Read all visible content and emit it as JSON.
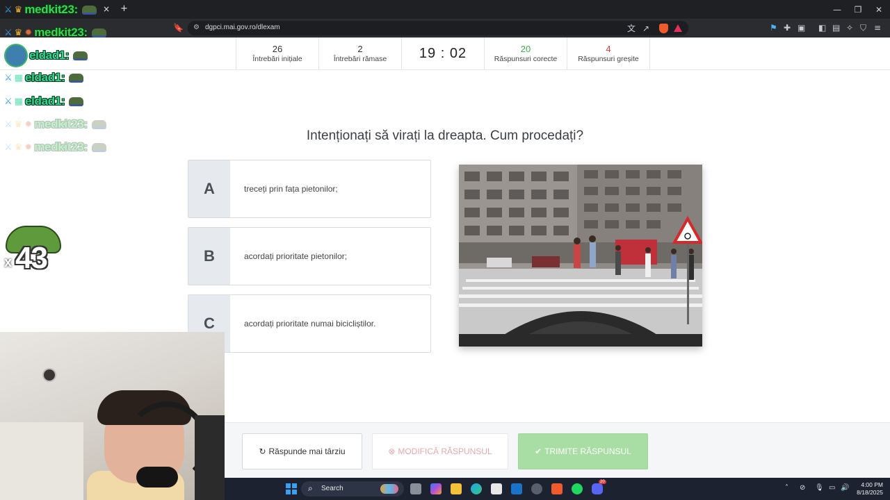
{
  "browser": {
    "url": "dgpci.mai.gov.ro/dlexam",
    "tab_close": "×",
    "tab_new": "+"
  },
  "stats": [
    {
      "value": "26",
      "label": "Întrebări inițiale"
    },
    {
      "value": "2",
      "label": "Întrebări rămase"
    },
    {
      "value": "19 : 02",
      "label": ""
    },
    {
      "value": "20",
      "label": "Răspunsuri corecte"
    },
    {
      "value": "4",
      "label": "Răspunsuri greșite"
    }
  ],
  "question": "Intenționați să virați la dreapta. Cum procedați?",
  "answers": [
    {
      "letter": "A",
      "text": "treceți prin fața pietonilor;"
    },
    {
      "letter": "B",
      "text": "acordați prioritate pietonilor;"
    },
    {
      "letter": "C",
      "text": "acordați prioritate numai bicicliștilor."
    }
  ],
  "buttons": {
    "later": "Răspunde mai târziu",
    "modify": "MODIFICĂ RĂSPUNSUL",
    "submit": "TRIMITE RĂSPUNSUL"
  },
  "taskbar": {
    "search": "Search",
    "time": "4:00 PM",
    "date": "8/18/2025",
    "notification_badge": "20"
  },
  "chat": [
    {
      "user": "medkit23:",
      "color": "#39d653"
    },
    {
      "user": "medkit23:",
      "color": "#39d653"
    },
    {
      "user": "eldad1:",
      "color": "#2fd69a"
    },
    {
      "user": "eldad1:",
      "color": "#2fd69a"
    },
    {
      "user": "eldad1:",
      "color": "#2fd69a"
    },
    {
      "user": "medkit23:",
      "color": "#39d653"
    },
    {
      "user": "medkit23:",
      "color": "#39d653"
    }
  ],
  "overlay_counter": "43",
  "overlay_counter_prefix": "x",
  "colors": {
    "correct": "#3fae49",
    "wrong": "#d63a3a",
    "submit_bg": "#a8dea4",
    "modify_text": "#e6a9b1"
  }
}
